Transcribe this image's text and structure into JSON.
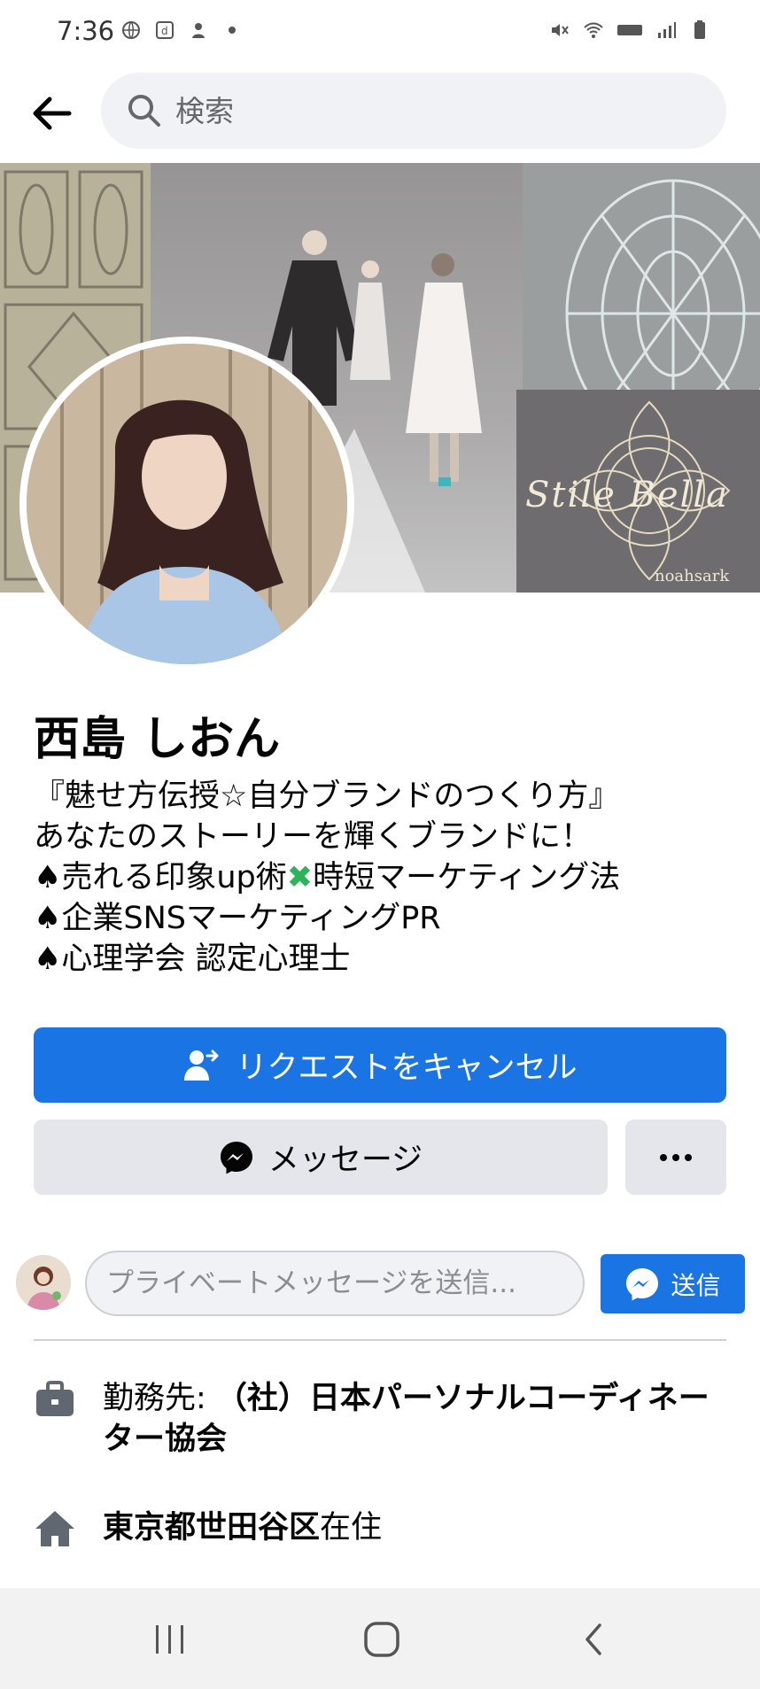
{
  "status_bar": {
    "time": "7:36"
  },
  "header": {
    "search_placeholder": "検索"
  },
  "cover": {
    "brand_text": "Stile Bella",
    "brand_sub": "noahsark"
  },
  "profile": {
    "name": "西島 しおん",
    "bio_lines": [
      "『魅せ方伝授☆自分ブランドのつくり方』",
      "あなたのストーリーを輝くブランドに！",
      "♠売れる印象up術",
      "時短マーケティング法",
      "♠企業SNSマーケティングPR",
      "♠心理学会 認定心理士"
    ]
  },
  "actions": {
    "cancel_request_label": "リクエストをキャンセル",
    "message_label": "メッセージ",
    "more_label": "•••"
  },
  "private_message": {
    "placeholder": "プライベートメッセージを送信...",
    "send_label": "送信"
  },
  "info": {
    "work_prefix": "勤務先: ",
    "work_org": "（社）日本パーソナルコーディネーター協会",
    "home_place": "東京都世田谷区",
    "home_suffix": "在住"
  },
  "colors": {
    "primary": "#1b74e4",
    "secondary_bg": "#e4e6eb",
    "text": "#050505",
    "muted": "#65676b"
  }
}
